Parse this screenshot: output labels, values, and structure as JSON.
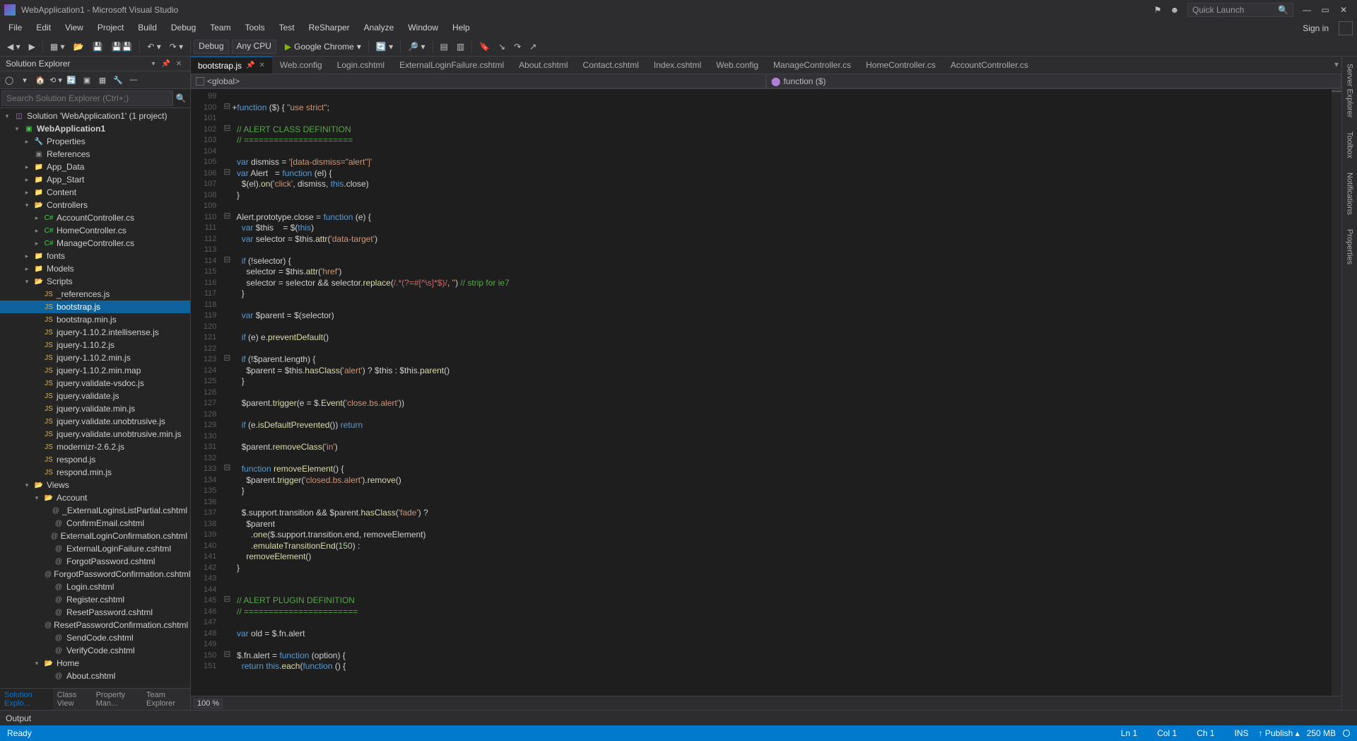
{
  "window": {
    "title": "WebApplication1 - Microsoft Visual Studio"
  },
  "quick_launch": {
    "placeholder": "Quick Launch"
  },
  "menu": [
    "File",
    "Edit",
    "View",
    "Project",
    "Build",
    "Debug",
    "Team",
    "Tools",
    "Test",
    "ReSharper",
    "Analyze",
    "Window",
    "Help"
  ],
  "signin": "Sign in",
  "toolbar": {
    "config": "Debug",
    "platform": "Any CPU",
    "start_target": "Google Chrome"
  },
  "solution_explorer": {
    "title": "Solution Explorer",
    "search_placeholder": "Search Solution Explorer (Ctrl+;)",
    "tabs": [
      "Solution Explo...",
      "Class View",
      "Property Man...",
      "Team Explorer"
    ],
    "tree": [
      {
        "depth": 0,
        "exp": "▾",
        "icon": "sln",
        "label": "Solution 'WebApplication1' (1 project)"
      },
      {
        "depth": 1,
        "exp": "▾",
        "icon": "proj",
        "label": "WebApplication1",
        "bold": true
      },
      {
        "depth": 2,
        "exp": "▸",
        "icon": "wrench",
        "label": "Properties"
      },
      {
        "depth": 2,
        "exp": "",
        "icon": "book",
        "label": "References"
      },
      {
        "depth": 2,
        "exp": "▸",
        "icon": "folder",
        "label": "App_Data"
      },
      {
        "depth": 2,
        "exp": "▸",
        "icon": "folder",
        "label": "App_Start"
      },
      {
        "depth": 2,
        "exp": "▸",
        "icon": "folder",
        "label": "Content"
      },
      {
        "depth": 2,
        "exp": "▾",
        "icon": "folder-open",
        "label": "Controllers"
      },
      {
        "depth": 3,
        "exp": "▸",
        "icon": "cs",
        "label": "AccountController.cs"
      },
      {
        "depth": 3,
        "exp": "▸",
        "icon": "cs",
        "label": "HomeController.cs"
      },
      {
        "depth": 3,
        "exp": "▸",
        "icon": "cs",
        "label": "ManageController.cs"
      },
      {
        "depth": 2,
        "exp": "▸",
        "icon": "folder",
        "label": "fonts"
      },
      {
        "depth": 2,
        "exp": "▸",
        "icon": "folder",
        "label": "Models"
      },
      {
        "depth": 2,
        "exp": "▾",
        "icon": "folder-open",
        "label": "Scripts"
      },
      {
        "depth": 3,
        "exp": "",
        "icon": "js",
        "label": "_references.js"
      },
      {
        "depth": 3,
        "exp": "",
        "icon": "js",
        "label": "bootstrap.js",
        "selected": true
      },
      {
        "depth": 3,
        "exp": "",
        "icon": "js",
        "label": "bootstrap.min.js"
      },
      {
        "depth": 3,
        "exp": "",
        "icon": "js",
        "label": "jquery-1.10.2.intellisense.js"
      },
      {
        "depth": 3,
        "exp": "",
        "icon": "js",
        "label": "jquery-1.10.2.js"
      },
      {
        "depth": 3,
        "exp": "",
        "icon": "js",
        "label": "jquery-1.10.2.min.js"
      },
      {
        "depth": 3,
        "exp": "",
        "icon": "js",
        "label": "jquery-1.10.2.min.map"
      },
      {
        "depth": 3,
        "exp": "",
        "icon": "js",
        "label": "jquery.validate-vsdoc.js"
      },
      {
        "depth": 3,
        "exp": "",
        "icon": "js",
        "label": "jquery.validate.js"
      },
      {
        "depth": 3,
        "exp": "",
        "icon": "js",
        "label": "jquery.validate.min.js"
      },
      {
        "depth": 3,
        "exp": "",
        "icon": "js",
        "label": "jquery.validate.unobtrusive.js"
      },
      {
        "depth": 3,
        "exp": "",
        "icon": "js",
        "label": "jquery.validate.unobtrusive.min.js"
      },
      {
        "depth": 3,
        "exp": "",
        "icon": "js",
        "label": "modernizr-2.6.2.js"
      },
      {
        "depth": 3,
        "exp": "",
        "icon": "js",
        "label": "respond.js"
      },
      {
        "depth": 3,
        "exp": "",
        "icon": "js",
        "label": "respond.min.js"
      },
      {
        "depth": 2,
        "exp": "▾",
        "icon": "folder-open",
        "label": "Views"
      },
      {
        "depth": 3,
        "exp": "▾",
        "icon": "folder-open",
        "label": "Account"
      },
      {
        "depth": 4,
        "exp": "",
        "icon": "cshtml",
        "label": "_ExternalLoginsListPartial.cshtml"
      },
      {
        "depth": 4,
        "exp": "",
        "icon": "cshtml",
        "label": "ConfirmEmail.cshtml"
      },
      {
        "depth": 4,
        "exp": "",
        "icon": "cshtml",
        "label": "ExternalLoginConfirmation.cshtml"
      },
      {
        "depth": 4,
        "exp": "",
        "icon": "cshtml",
        "label": "ExternalLoginFailure.cshtml"
      },
      {
        "depth": 4,
        "exp": "",
        "icon": "cshtml",
        "label": "ForgotPassword.cshtml"
      },
      {
        "depth": 4,
        "exp": "",
        "icon": "cshtml",
        "label": "ForgotPasswordConfirmation.cshtml"
      },
      {
        "depth": 4,
        "exp": "",
        "icon": "cshtml",
        "label": "Login.cshtml"
      },
      {
        "depth": 4,
        "exp": "",
        "icon": "cshtml",
        "label": "Register.cshtml"
      },
      {
        "depth": 4,
        "exp": "",
        "icon": "cshtml",
        "label": "ResetPassword.cshtml"
      },
      {
        "depth": 4,
        "exp": "",
        "icon": "cshtml",
        "label": "ResetPasswordConfirmation.cshtml"
      },
      {
        "depth": 4,
        "exp": "",
        "icon": "cshtml",
        "label": "SendCode.cshtml"
      },
      {
        "depth": 4,
        "exp": "",
        "icon": "cshtml",
        "label": "VerifyCode.cshtml"
      },
      {
        "depth": 3,
        "exp": "▾",
        "icon": "folder-open",
        "label": "Home"
      },
      {
        "depth": 4,
        "exp": "",
        "icon": "cshtml",
        "label": "About.cshtml"
      }
    ]
  },
  "tabs": [
    {
      "label": "bootstrap.js",
      "active": true,
      "pin": true
    },
    {
      "label": "Web.config"
    },
    {
      "label": "Login.cshtml"
    },
    {
      "label": "ExternalLoginFailure.cshtml"
    },
    {
      "label": "About.cshtml"
    },
    {
      "label": "Contact.cshtml"
    },
    {
      "label": "Index.cshtml"
    },
    {
      "label": "Web.config"
    },
    {
      "label": "ManageController.cs"
    },
    {
      "label": "HomeController.cs"
    },
    {
      "label": "AccountController.cs"
    }
  ],
  "nav_combo": {
    "left": "<global>",
    "right": "function ($)"
  },
  "code": {
    "first_line": 99,
    "lines": [
      {
        "fold": "",
        "html": ""
      },
      {
        "fold": "⊟",
        "html": "+<span class='kw'>function</span> ($) { <span class='str'>\"use strict\"</span>;"
      },
      {
        "fold": "",
        "html": ""
      },
      {
        "fold": "⊟",
        "html": "  <span class='cm'>// ALERT CLASS DEFINITION</span>"
      },
      {
        "fold": "",
        "html": "  <span class='cm'>// ======================</span>"
      },
      {
        "fold": "",
        "html": ""
      },
      {
        "fold": "",
        "html": "  <span class='kw'>var</span> dismiss = <span class='str'>'[data-dismiss=\"alert\"]'</span>"
      },
      {
        "fold": "⊟",
        "html": "  <span class='kw'>var</span> Alert   = <span class='kw'>function</span> (el) {"
      },
      {
        "fold": "",
        "html": "    $(el).<span class='fn'>on</span>(<span class='str'>'click'</span>, dismiss, <span class='th'>this</span>.close)"
      },
      {
        "fold": "",
        "html": "  }"
      },
      {
        "fold": "",
        "html": ""
      },
      {
        "fold": "⊟",
        "html": "  Alert.<span class='prop'>prototype</span>.close = <span class='kw'>function</span> (e) {"
      },
      {
        "fold": "",
        "html": "    <span class='kw'>var</span> $this    = $(<span class='th'>this</span>)"
      },
      {
        "fold": "",
        "html": "    <span class='kw'>var</span> selector = $this.<span class='fn'>attr</span>(<span class='str'>'data-target'</span>)"
      },
      {
        "fold": "",
        "html": ""
      },
      {
        "fold": "⊟",
        "html": "    <span class='kw'>if</span> (!selector) {"
      },
      {
        "fold": "",
        "html": "      selector = $this.<span class='fn'>attr</span>(<span class='str'>'href'</span>)"
      },
      {
        "fold": "",
        "html": "      selector = selector && selector.<span class='fn'>replace</span>(<span class='rex'>/.*(?=#[^\\s]*$)/</span>, <span class='str'>''</span>) <span class='cm'>// strip for ie7</span>"
      },
      {
        "fold": "",
        "html": "    }"
      },
      {
        "fold": "",
        "html": ""
      },
      {
        "fold": "",
        "html": "    <span class='kw'>var</span> $parent = $(selector)"
      },
      {
        "fold": "",
        "html": ""
      },
      {
        "fold": "",
        "html": "    <span class='kw'>if</span> (e) e.<span class='fn'>preventDefault</span>()"
      },
      {
        "fold": "",
        "html": ""
      },
      {
        "fold": "⊟",
        "html": "    <span class='kw'>if</span> (!$parent.length) {"
      },
      {
        "fold": "",
        "html": "      $parent = $this.<span class='fn'>hasClass</span>(<span class='str'>'alert'</span>) ? $this : $this.<span class='fn'>parent</span>()"
      },
      {
        "fold": "",
        "html": "    }"
      },
      {
        "fold": "",
        "html": ""
      },
      {
        "fold": "",
        "html": "    $parent.<span class='fn'>trigger</span>(e = $.<span class='fn'>Event</span>(<span class='str'>'close.bs.alert'</span>))"
      },
      {
        "fold": "",
        "html": ""
      },
      {
        "fold": "",
        "html": "    <span class='kw'>if</span> (e.<span class='fn'>isDefaultPrevented</span>()) <span class='kw'>return</span>"
      },
      {
        "fold": "",
        "html": ""
      },
      {
        "fold": "",
        "html": "    $parent.<span class='fn'>removeClass</span>(<span class='str'>'in'</span>)"
      },
      {
        "fold": "",
        "html": ""
      },
      {
        "fold": "⊟",
        "html": "    <span class='kw'>function</span> <span class='fn'>removeElement</span>() {"
      },
      {
        "fold": "",
        "html": "      $parent.<span class='fn'>trigger</span>(<span class='str'>'closed.bs.alert'</span>).<span class='fn'>remove</span>()"
      },
      {
        "fold": "",
        "html": "    }"
      },
      {
        "fold": "",
        "html": ""
      },
      {
        "fold": "",
        "html": "    $.support.transition && $parent.<span class='fn'>hasClass</span>(<span class='str'>'fade'</span>) ?"
      },
      {
        "fold": "",
        "html": "      $parent"
      },
      {
        "fold": "",
        "html": "        .<span class='fn'>one</span>($.support.transition.end, removeElement)"
      },
      {
        "fold": "",
        "html": "        .<span class='fn'>emulateTransitionEnd</span>(<span class='num'>150</span>) :"
      },
      {
        "fold": "",
        "html": "      <span class='fn'>removeElement</span>()"
      },
      {
        "fold": "",
        "html": "  }"
      },
      {
        "fold": "",
        "html": ""
      },
      {
        "fold": "",
        "html": ""
      },
      {
        "fold": "⊟",
        "html": "  <span class='cm'>// ALERT PLUGIN DEFINITION</span>"
      },
      {
        "fold": "",
        "html": "  <span class='cm'>// =======================</span>"
      },
      {
        "fold": "",
        "html": ""
      },
      {
        "fold": "",
        "html": "  <span class='kw'>var</span> old = $.fn.alert"
      },
      {
        "fold": "",
        "html": ""
      },
      {
        "fold": "⊟",
        "html": "  $.fn.alert = <span class='kw'>function</span> (option) {"
      },
      {
        "fold": "",
        "html": "    <span class='kw'>return</span> <span class='th'>this</span>.<span class='fn'>each</span>(<span class='kw'>function</span> () {"
      }
    ]
  },
  "zoom": "100 %",
  "right_rail": [
    "Server Explorer",
    "Toolbox",
    "Notifications",
    "Properties"
  ],
  "output": {
    "title": "Output"
  },
  "status": {
    "ready": "Ready",
    "ln": "Ln 1",
    "col": "Col 1",
    "ch": "Ch 1",
    "ins": "INS",
    "publish": "Publish",
    "memory": "250 MB"
  }
}
